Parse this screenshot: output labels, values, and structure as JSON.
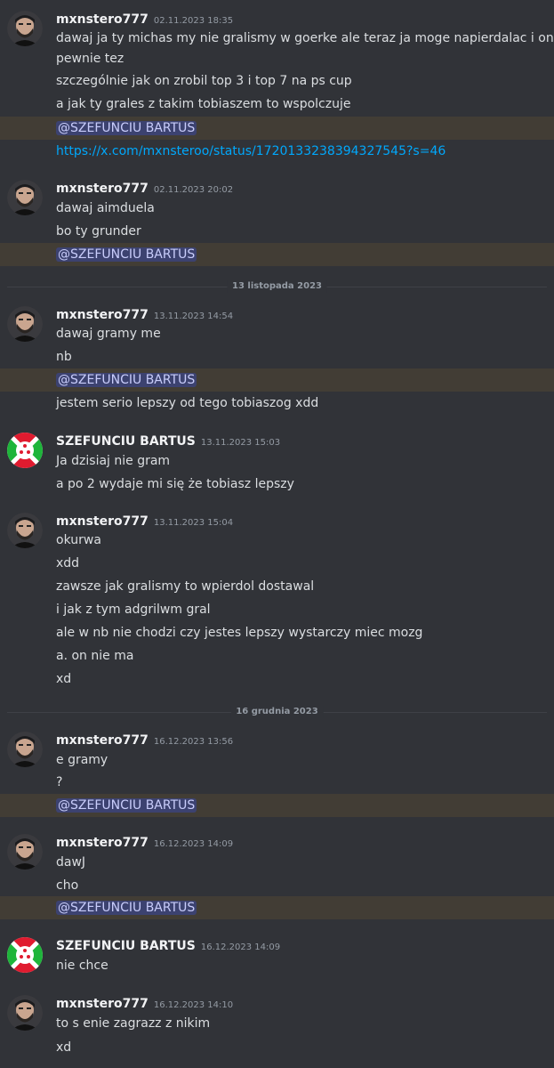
{
  "colors": {
    "background": "#313338",
    "mention_bg": "#3c4270",
    "mention_text": "#c9cdfb",
    "mention_line_bg": "#423d35",
    "link": "#00a8fc",
    "timestamp": "#949ba4"
  },
  "authors": {
    "a": "mxnstero777",
    "b": "SZEFUNCIU BARTUS"
  },
  "mention_text": "@SZEFUNCIU BARTUS",
  "dates": {
    "d13": "13 listopada 2023",
    "d16": "16 grudnia 2023"
  },
  "g1": {
    "ts": "02.11.2023 18:35",
    "m1": "dawaj ja ty michas my nie gralismy w goerke ale teraz ja moge napierdalac i on",
    "m1b": "pewnie tez",
    "m2": "szczególnie jak on zrobil top 3 i top 7 na ps cup",
    "m3": "a jak ty grales z takim tobiaszem to wspolczuje",
    "link": "https://x.com/mxnsteroo/status/1720133238394327545?s=46"
  },
  "g2": {
    "ts": "02.11.2023 20:02",
    "m1": "dawaj aimduela",
    "m2": "bo ty grunder"
  },
  "g3": {
    "ts": "13.11.2023 14:54",
    "m1": "dawaj gramy me",
    "m2": "nb",
    "m3": "jestem serio lepszy od tego tobiaszog xdd"
  },
  "g4": {
    "ts": "13.11.2023 15:03",
    "m1": "Ja dzisiaj nie gram",
    "m2": "a po 2 wydaje mi się że tobiasz lepszy"
  },
  "g5": {
    "ts": "13.11.2023 15:04",
    "m1": "okurwa",
    "m2": "xdd",
    "m3": "zawsze jak gralismy to wpierdol dostawal",
    "m4": "i jak z tym adgrilwm gral",
    "m5": "ale w nb nie chodzi czy jestes lepszy wystarczy miec mozg",
    "m6": "a. on nie ma",
    "m7": "xd"
  },
  "g6": {
    "ts": "16.12.2023 13:56",
    "m1": "e gramy",
    "m2": "?"
  },
  "g7": {
    "ts": "16.12.2023 14:09",
    "m1": "dawJ",
    "m2": "cho"
  },
  "g8": {
    "ts": "16.12.2023 14:09",
    "m1": "nie chce"
  },
  "g9": {
    "ts": "16.12.2023 14:10",
    "m1": "to s enie zagrazz z nikim",
    "m2": "xd"
  }
}
